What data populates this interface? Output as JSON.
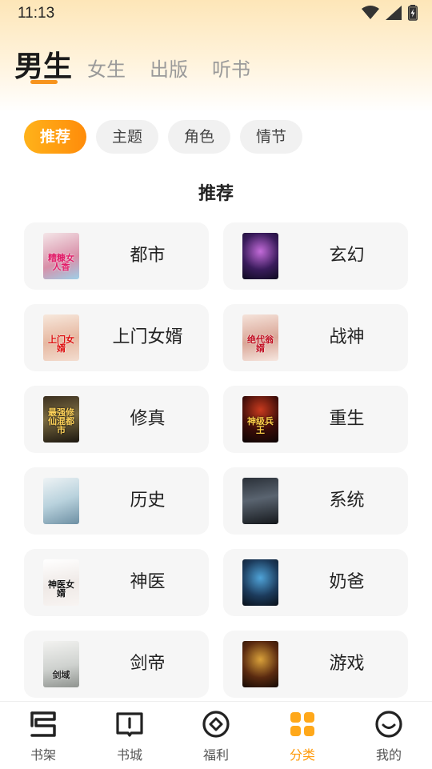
{
  "status_bar": {
    "time": "11:13",
    "icons": [
      "wifi-icon",
      "signal-icon",
      "battery-charging-icon"
    ]
  },
  "main_tabs": [
    {
      "label": "男生",
      "active": true
    },
    {
      "label": "女生",
      "active": false
    },
    {
      "label": "出版",
      "active": false
    },
    {
      "label": "听书",
      "active": false
    }
  ],
  "filter_chips": [
    {
      "label": "推荐",
      "active": true
    },
    {
      "label": "主题",
      "active": false
    },
    {
      "label": "角色",
      "active": false
    },
    {
      "label": "情节",
      "active": false
    }
  ],
  "section_title": "推荐",
  "categories": [
    {
      "label": "都市",
      "cover_title": "糟糠女人香"
    },
    {
      "label": "玄幻",
      "cover_title": ""
    },
    {
      "label": "上门女婿",
      "cover_title": "上门女婿"
    },
    {
      "label": "战神",
      "cover_title": "绝代翁婿"
    },
    {
      "label": "修真",
      "cover_title": "最强修仙混都市"
    },
    {
      "label": "重生",
      "cover_title": "神级兵王"
    },
    {
      "label": "历史",
      "cover_title": ""
    },
    {
      "label": "系统",
      "cover_title": ""
    },
    {
      "label": "神医",
      "cover_title": "神医女婿"
    },
    {
      "label": "奶爸",
      "cover_title": ""
    },
    {
      "label": "剑帝",
      "cover_title": "剑域"
    },
    {
      "label": "游戏",
      "cover_title": ""
    }
  ],
  "bottom_nav": [
    {
      "label": "书架",
      "icon": "bookshelf-icon",
      "active": false
    },
    {
      "label": "书城",
      "icon": "bookstore-icon",
      "active": false
    },
    {
      "label": "福利",
      "icon": "welfare-icon",
      "active": false
    },
    {
      "label": "分类",
      "icon": "category-icon",
      "active": true
    },
    {
      "label": "我的",
      "icon": "profile-icon",
      "active": false
    }
  ],
  "colors": {
    "accent": "#ff9a0a",
    "chip_bg": "#f1f1f1",
    "card_bg": "#f6f6f6"
  }
}
